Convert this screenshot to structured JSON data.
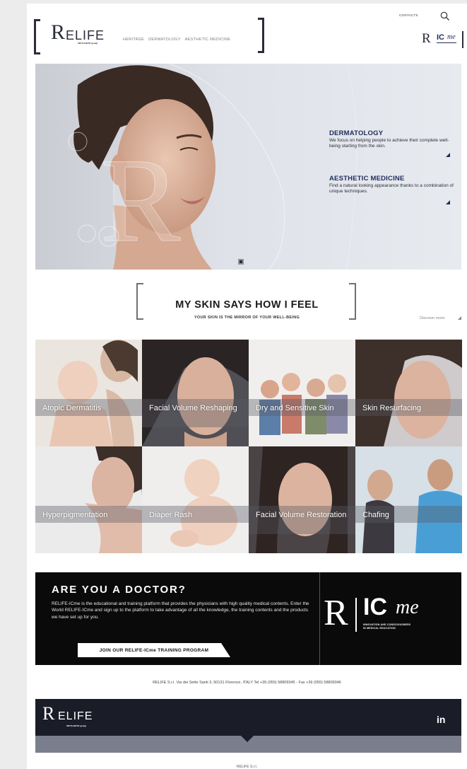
{
  "header": {
    "logo": {
      "letter": "R",
      "word": "ELIFE",
      "sub": "MENARINI group"
    },
    "nav": [
      "HERITAGE",
      "DERMATOLOGY",
      "AESTHETIC MEDICINE"
    ],
    "contacts": "CONTACTS",
    "icme_logo": {
      "letter": "R",
      "ic": "IC",
      "me": "me"
    }
  },
  "hero": {
    "blocks": [
      {
        "title": "DERMATOLOGY",
        "text": "We focus on helping people to achieve their complete well-being starting from the skin."
      },
      {
        "title": "AESTHETIC MEDICINE",
        "text": "Find a natural looking appearance thanks to a combination of unique techniques."
      }
    ]
  },
  "tagline": {
    "title": "MY SKIN SAYS HOW I FEEL",
    "subtitle": "YOUR SKIN IS THE MIRROR OF YOUR WELL-BEING",
    "discover": "Discover more"
  },
  "tiles": [
    {
      "label": "Atopic Dermatitis"
    },
    {
      "label": "Facial Volume Reshaping"
    },
    {
      "label": "Dry and Sensitive Skin"
    },
    {
      "label": "Skin Resurfacing"
    },
    {
      "label": "Hyperpigmentation"
    },
    {
      "label": "Diaper Rash"
    },
    {
      "label": "Facial Volume Restoration"
    },
    {
      "label": "Chafing"
    }
  ],
  "doctor": {
    "title": "ARE YOU A DOCTOR?",
    "text": "RELIFE-ICme is the educational and training platform that provides the physicians with high quality medical contents. Enter the World RELIFE-ICme and sign up to the platform to take advantage of all the knowledge, the training contents and the products we have set up for you.",
    "button": "JOIN OUR RELIFE-ICme TRAINING PROGRAM",
    "logo": {
      "letter": "R",
      "ic": "IC",
      "me": "me",
      "tag1": "INNOVATION AND CONSCIOUSNESS",
      "tag2": "IN MEDICAL EDUCATION"
    }
  },
  "address": "RELIFE S.r.l. Via dei Sette Santi 3, 50131 Florence, ITALY Tel +39 (055) 58809345 - Fax +39 (055) 58809346",
  "footer": {
    "logo": {
      "letter": "R",
      "word": "ELIFE",
      "sub": "MENARINI group"
    },
    "social": "in",
    "bottom": "RELIFE S.r.l."
  },
  "colors": {
    "navy": "#1f2c5c",
    "footer": "#1a1d28",
    "doctor_bg": "#0a0a0a"
  }
}
